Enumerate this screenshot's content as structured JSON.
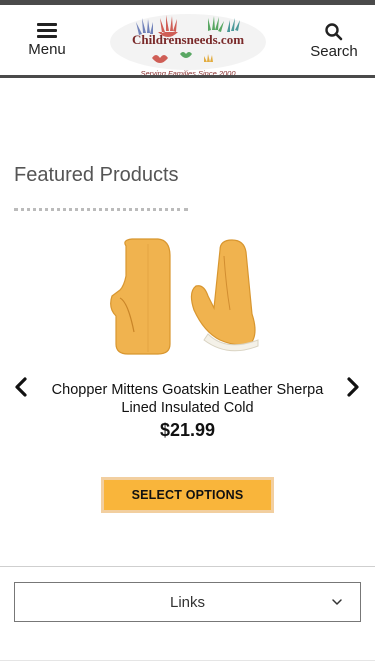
{
  "header": {
    "menu_label": "Menu",
    "menu_icon": "hamburger-icon",
    "search_label": "Search",
    "search_icon": "magnifier-icon",
    "logo_text": "Childrensneeds.com",
    "logo_tagline": "Serving Families Since 2000"
  },
  "featured": {
    "title": "Featured Products",
    "product": {
      "name": "Chopper Mittens Goatskin Leather Sherpa Lined Insulated Cold",
      "price": "$21.99",
      "button_label": "SELECT OPTIONS"
    },
    "prev_icon": "chevron-left-icon",
    "next_icon": "chevron-right-icon"
  },
  "footer": {
    "links_label": "Links",
    "links_icon": "chevron-down-icon"
  },
  "colors": {
    "accent": "#f9b53b",
    "accent_border": "#f2cfa0",
    "header_rule": "#4a4a4a",
    "mitten": "#f0b34f"
  }
}
